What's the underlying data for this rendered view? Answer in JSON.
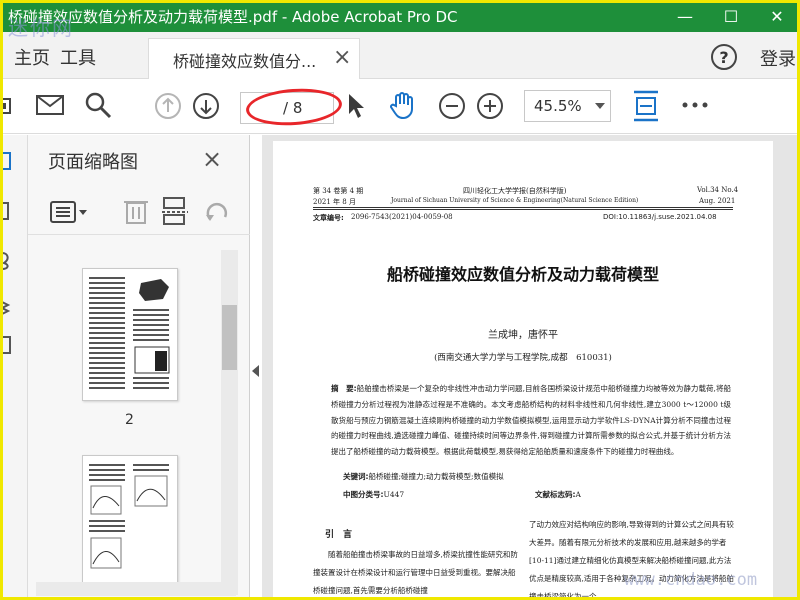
{
  "window": {
    "title": "桥碰撞效应数值分析及动力载荷模型.pdf - Adobe Acrobat Pro DC",
    "controls": [
      "—",
      "☐",
      "✕"
    ],
    "title_bar_color": "#1e8f3a"
  },
  "watermarks": {
    "top_left": "迷你网",
    "bottom_right": "www.cndao.com"
  },
  "menu": {
    "home": "主页",
    "tools": "工具"
  },
  "tab": {
    "label": "桥碰撞效应数值分...",
    "close": "×"
  },
  "header_right": {
    "help": "?",
    "login": "登录"
  },
  "toolbar": {
    "page_current": "",
    "page_total": "/ 8",
    "zoom": "45.5%",
    "icons": [
      "print-icon",
      "email-icon",
      "search-icon",
      "page-up-icon",
      "page-down-icon",
      "select-cursor-icon",
      "hand-tool-icon",
      "zoom-out-icon",
      "zoom-in-icon",
      "fit-page-icon",
      "more-icon"
    ]
  },
  "thumbnails_panel": {
    "title": "页面缩略图",
    "close": "×",
    "page_labels": [
      "2"
    ]
  },
  "document": {
    "header_left_1": "第 34 卷第 4 期",
    "header_left_2": "2021 年 8 月",
    "header_center_1": "四川轻化工大学学报(自然科学版)",
    "header_center_2": "Journal of Sichuan University of Science & Engineering(Natural Science Edition)",
    "header_right_1": "Vol.34 No.4",
    "header_right_2": "Aug. 2021",
    "article_no_label": "文章编号:",
    "article_no": "2096-7543(2021)04-0059-08",
    "doi": "DOI:10.11863/j.suse.2021.04.08",
    "title": "船桥碰撞效应数值分析及动力载荷模型",
    "authors": "兰成坤，唐怀平",
    "affiliation": "(西南交通大学力学与工程学院,成都　610031)",
    "abstract_label": "摘　要:",
    "abstract": "船舶撞击桥梁是一个复杂的非线性冲击动力学问题,目前各国桥梁设计规范中船桥碰撞力均被等效为静力载荷,将船桥碰撞力分析过程视为准静态过程是不准确的。本文考虑船桥结构的材料非线性和几何非线性,建立3000 t～12000 t级散货船与预应力钢筋混凝土连续刚构桥碰撞的动力学数值模拟模型,运用显示动力学软件LS-DYNA计算分析不同撞击过程的碰撞力时程曲线,遴选碰撞力峰值、碰撞持续时间等边界条件,得到碰撞力计算所需参数的拟合公式,并基于统计分析方法提出了船桥碰撞的动力载荷模型。根据此荷载模型,易获得给定船舶质量和速度条件下的碰撞力时程曲线。",
    "keywords_label": "关键词:",
    "keywords": "船桥碰撞;碰撞力;动力载荷模型;数值模拟",
    "clc_label": "中图分类号:",
    "clc": "U447",
    "doc_code_label": "文献标志码:",
    "doc_code": "A",
    "section_heading": "引　言",
    "left_col": "随着船舶撞击桥梁事故的日益增多,桥梁抗撞性能研究和防撞装置设计在桥梁设计和运行管理中日益受到重视。要解决船桥碰撞问题,首先需要分析船桥碰撞",
    "right_col": "了动力效应对结构响应的影响,导致得到的计算公式之间具有较大差异。随着有限元分析技术的发展和应用,越来越多的学者[10-11]通过建立精细化仿真模型来解决船桥碰撞问题,此方法优点是精度较高,适用于各种复杂工况。动力简化方法是将船舶撞击桥梁简化为一个"
  }
}
